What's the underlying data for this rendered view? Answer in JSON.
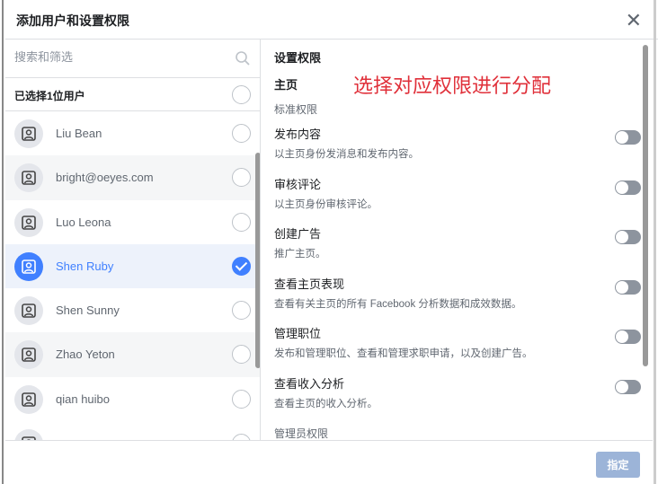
{
  "dialog": {
    "title": "添加用户和设置权限"
  },
  "search": {
    "placeholder": "搜索和筛选"
  },
  "selection": {
    "count_label": "已选择1位用户"
  },
  "users": [
    {
      "name": "Liu Bean",
      "selected": false
    },
    {
      "name": "bright@oeyes.com",
      "selected": false
    },
    {
      "name": "Luo Leona",
      "selected": false
    },
    {
      "name": "Shen Ruby",
      "selected": true
    },
    {
      "name": "Shen Sunny",
      "selected": false
    },
    {
      "name": "Zhao Yeton",
      "selected": false
    },
    {
      "name": "qian huibo",
      "selected": false
    }
  ],
  "permissions": {
    "heading": "设置权限",
    "section": "主页",
    "annotation": "选择对应权限进行分配",
    "standard_label": "标准权限",
    "items": [
      {
        "title": "发布内容",
        "desc": "以主页身份发消息和发布内容。",
        "enabled": false
      },
      {
        "title": "审核评论",
        "desc": "以主页身份审核评论。",
        "enabled": false
      },
      {
        "title": "创建广告",
        "desc": "推广主页。",
        "enabled": false
      },
      {
        "title": "查看主页表现",
        "desc": "查看有关主页的所有 Facebook 分析数据和成效数据。",
        "enabled": false
      },
      {
        "title": "管理职位",
        "desc": "发布和管理职位、查看和管理求职申请，以及创建广告。",
        "enabled": false
      },
      {
        "title": "查看收入分析",
        "desc": "查看主页的收入分析。",
        "enabled": false
      }
    ],
    "admin_label": "管理员权限"
  },
  "footer": {
    "confirm_label": "指定"
  },
  "colors": {
    "accent": "#4080ff",
    "annotation": "#e0303a",
    "button_disabled": "#9cb4d8"
  }
}
